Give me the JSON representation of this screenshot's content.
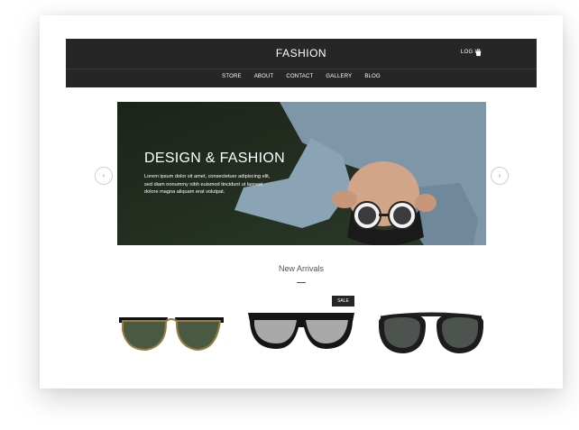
{
  "brand": "FASHION",
  "header": {
    "login_label": "LOG IN",
    "cart_icon": "cart-icon"
  },
  "nav": {
    "items": [
      "STORE",
      "ABOUT",
      "CONTACT",
      "GALLERY",
      "BLOG"
    ]
  },
  "hero": {
    "title": "DESIGN & FASHION",
    "text": "Lorem ipsum dolor sit amet, consectetuer adipiscing elit, sed diam nonummy nibh euismod tincidunt ut laoreet dolore magna aliquam erat volutpat.",
    "prev_icon": "chevron-left-icon",
    "next_icon": "chevron-right-icon"
  },
  "section": {
    "title": "New Arrivals"
  },
  "products": [
    {
      "name": "sunglasses-1",
      "badge": ""
    },
    {
      "name": "sunglasses-2",
      "badge": "SALE"
    },
    {
      "name": "sunglasses-3",
      "badge": ""
    }
  ],
  "colors": {
    "bar": "#262626",
    "accent": "#ffffff",
    "text": "#555555"
  }
}
